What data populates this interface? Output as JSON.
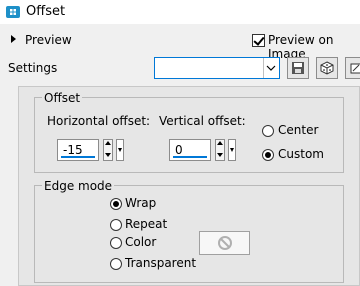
{
  "window": {
    "title": "Offset"
  },
  "header": {
    "preview_label": "Preview",
    "preview_on_image_label": "Preview on Image",
    "preview_on_image_checked": true,
    "settings_label": "Settings",
    "settings_value": ""
  },
  "offset": {
    "group_title": "Offset",
    "horizontal_label": "Horizontal offset:",
    "horizontal_value": "-15",
    "vertical_label": "Vertical offset:",
    "vertical_value": "0",
    "options": [
      {
        "label": "Center",
        "selected": false
      },
      {
        "label": "Custom",
        "selected": true
      }
    ]
  },
  "edge_mode": {
    "group_title": "Edge mode",
    "options": [
      {
        "label": "Wrap",
        "selected": true
      },
      {
        "label": "Repeat",
        "selected": false
      },
      {
        "label": "Color",
        "selected": false
      },
      {
        "label": "Transparent",
        "selected": false
      }
    ]
  },
  "icons": {
    "app": "offset-app-icon",
    "save": "floppy-disk-icon",
    "random": "dice-icon",
    "third": "tool-icon",
    "color_none": "no-color-icon"
  },
  "colors": {
    "accent": "#0078d7",
    "app_icon": "#1e90c8"
  }
}
